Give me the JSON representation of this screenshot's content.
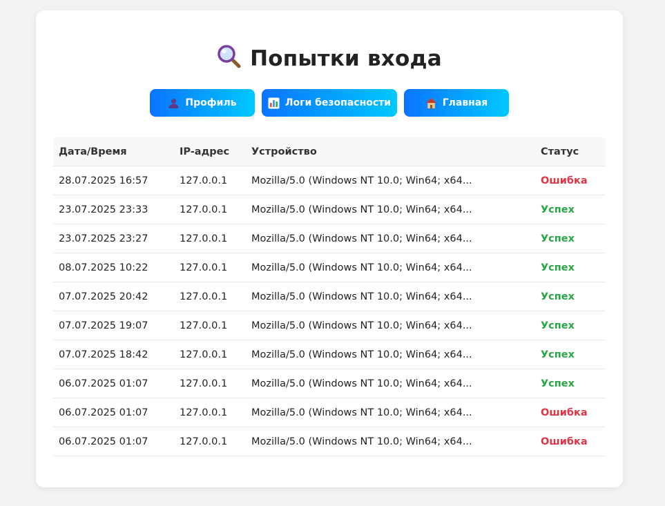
{
  "page": {
    "title": "Попытки входа",
    "title_icon": "magnifier-icon"
  },
  "nav": {
    "profile": {
      "label": "Профиль",
      "icon": "user-icon"
    },
    "security_logs": {
      "label": "Логи безопасности",
      "icon": "bar-chart-icon"
    },
    "home": {
      "label": "Главная",
      "icon": "house-icon"
    }
  },
  "table": {
    "headers": {
      "datetime": "Дата/Время",
      "ip": "IP-адрес",
      "device": "Устройство",
      "status": "Статус"
    },
    "rows": [
      {
        "datetime": "28.07.2025 16:57",
        "ip": "127.0.0.1",
        "device": "Mozilla/5.0 (Windows NT 10.0; Win64; x64...",
        "status": "Ошибка",
        "ok": false
      },
      {
        "datetime": "23.07.2025 23:33",
        "ip": "127.0.0.1",
        "device": "Mozilla/5.0 (Windows NT 10.0; Win64; x64...",
        "status": "Успех",
        "ok": true
      },
      {
        "datetime": "23.07.2025 23:27",
        "ip": "127.0.0.1",
        "device": "Mozilla/5.0 (Windows NT 10.0; Win64; x64...",
        "status": "Успех",
        "ok": true
      },
      {
        "datetime": "08.07.2025 10:22",
        "ip": "127.0.0.1",
        "device": "Mozilla/5.0 (Windows NT 10.0; Win64; x64...",
        "status": "Успех",
        "ok": true
      },
      {
        "datetime": "07.07.2025 20:42",
        "ip": "127.0.0.1",
        "device": "Mozilla/5.0 (Windows NT 10.0; Win64; x64...",
        "status": "Успех",
        "ok": true
      },
      {
        "datetime": "07.07.2025 19:07",
        "ip": "127.0.0.1",
        "device": "Mozilla/5.0 (Windows NT 10.0; Win64; x64...",
        "status": "Успех",
        "ok": true
      },
      {
        "datetime": "07.07.2025 18:42",
        "ip": "127.0.0.1",
        "device": "Mozilla/5.0 (Windows NT 10.0; Win64; x64...",
        "status": "Успех",
        "ok": true
      },
      {
        "datetime": "06.07.2025 01:07",
        "ip": "127.0.0.1",
        "device": "Mozilla/5.0 (Windows NT 10.0; Win64; x64...",
        "status": "Успех",
        "ok": true
      },
      {
        "datetime": "06.07.2025 01:07",
        "ip": "127.0.0.1",
        "device": "Mozilla/5.0 (Windows NT 10.0; Win64; x64...",
        "status": "Ошибка",
        "ok": false
      },
      {
        "datetime": "06.07.2025 01:07",
        "ip": "127.0.0.1",
        "device": "Mozilla/5.0 (Windows NT 10.0; Win64; x64...",
        "status": "Ошибка",
        "ok": false
      }
    ]
  },
  "colors": {
    "success": "#28a745",
    "error": "#dc3545",
    "button_gradient_start": "#0a74ff",
    "button_gradient_end": "#00c8ff"
  }
}
